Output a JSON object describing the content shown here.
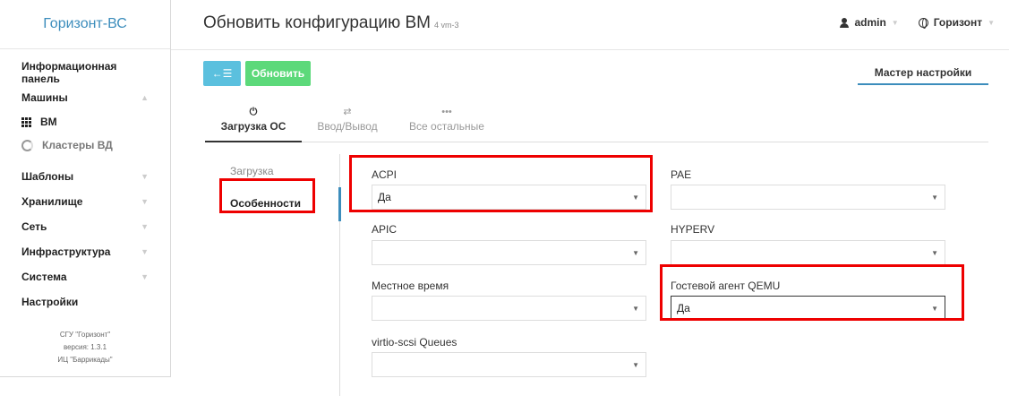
{
  "brand": "Горизонт-ВС",
  "sidebar": {
    "items": [
      {
        "label": "Информационная панель"
      },
      {
        "label": "Машины"
      },
      {
        "label": "ВМ"
      },
      {
        "label": "Кластеры ВД"
      },
      {
        "label": "Шаблоны"
      },
      {
        "label": "Хранилище"
      },
      {
        "label": "Сеть"
      },
      {
        "label": "Инфраструктура"
      },
      {
        "label": "Система"
      },
      {
        "label": "Настройки"
      }
    ],
    "version_lines": [
      "СГУ \"Горизонт\"",
      "версия: 1.3.1",
      "ИЦ \"Баррикады\""
    ]
  },
  "header": {
    "title": "Обновить конфигурацию ВМ",
    "subtitle": "4 vm-3",
    "user": "admin",
    "zone": "Горизонт"
  },
  "toolbar": {
    "back_icon": "←☰",
    "update_label": "Обновить",
    "wizard_label": "Мастер настройки"
  },
  "tabs": [
    {
      "icon": "power-icon",
      "glyph": "⏻",
      "label": "Загрузка ОС"
    },
    {
      "icon": "exchange-icon",
      "glyph": "⇄",
      "label": "Ввод/Вывод"
    },
    {
      "icon": "ellipsis-icon",
      "glyph": "•••",
      "label": "Все остальные"
    }
  ],
  "subnav": [
    {
      "label": "Загрузка"
    },
    {
      "label": "Особенности"
    }
  ],
  "fields": {
    "acpi": {
      "label": "ACPI",
      "value": "Да"
    },
    "pae": {
      "label": "PAE",
      "value": ""
    },
    "apic": {
      "label": "APIC",
      "value": ""
    },
    "hyperv": {
      "label": "HYPERV",
      "value": ""
    },
    "localtime": {
      "label": "Местное время",
      "value": ""
    },
    "qemu_agent": {
      "label": "Гостевой агент QEMU",
      "value": "Да"
    },
    "virtio_scsi": {
      "label": "virtio-scsi Queues",
      "value": ""
    }
  },
  "colors": {
    "brand": "#3c8dbc",
    "back_button": "#5bc0de",
    "update_button": "#5cd97a",
    "highlight": "#ee0000"
  }
}
